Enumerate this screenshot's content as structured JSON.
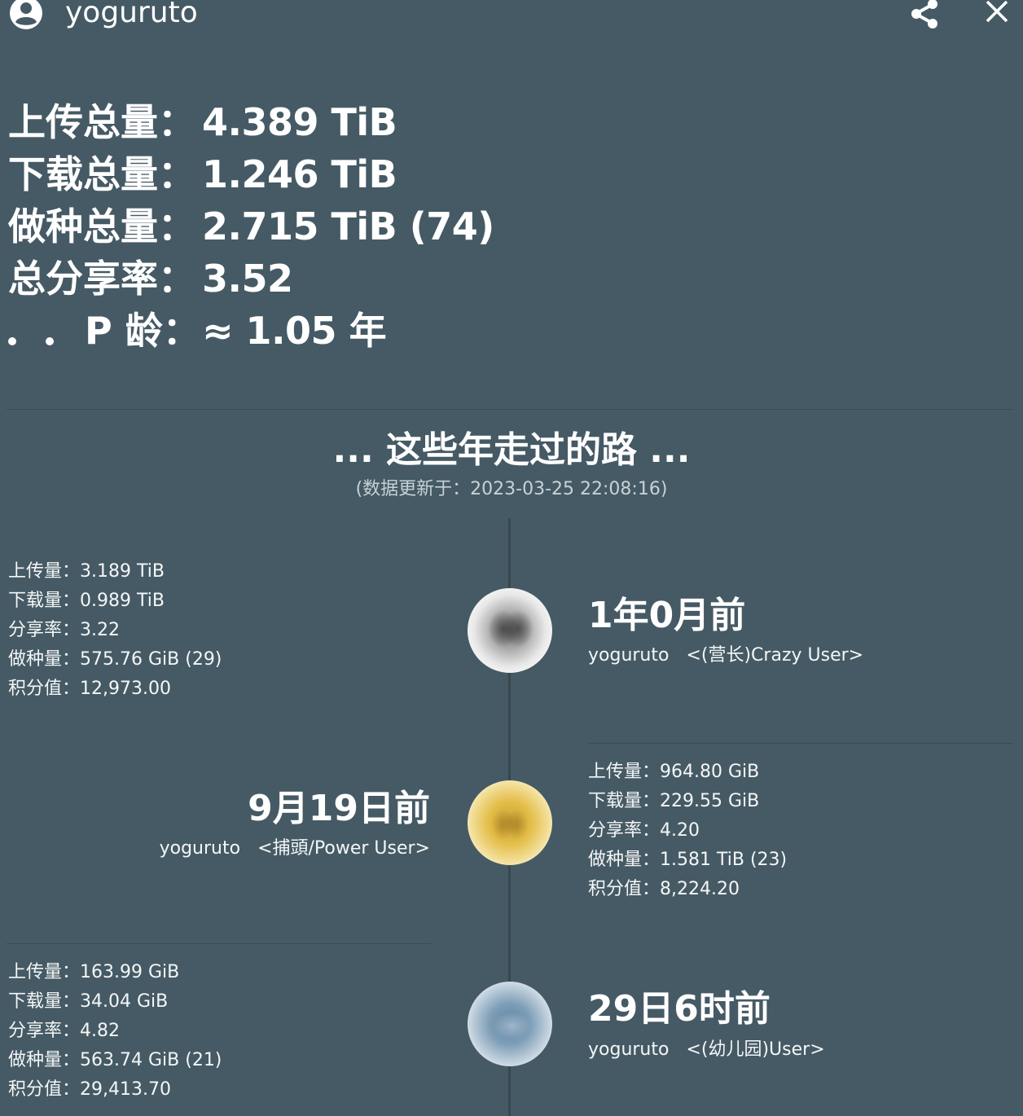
{
  "header": {
    "username": "yoguruto",
    "avatar_icon": "account-circle-icon",
    "share_icon": "share-icon",
    "close_icon": "close-icon"
  },
  "totals": [
    {
      "label": "上传总量：",
      "value": "4.389 TiB"
    },
    {
      "label": "下载总量：",
      "value": "1.246 TiB"
    },
    {
      "label": "做种总量：",
      "value": "2.715 TiB (74)"
    },
    {
      "label": "总分享率：",
      "value": "3.52"
    },
    {
      "label": "P 龄：",
      "value": "≈ 1.05 年"
    }
  ],
  "timeline": {
    "title": "... 这些年走过的路 ...",
    "subtitle": "(数据更新于：2023-03-25 22:08:16)",
    "entries": [
      {
        "ago": "1年0月前",
        "username": "yoguruto",
        "class": "<(营长)Crazy User>",
        "stats": [
          {
            "label": "上传量：",
            "value": "3.189 TiB"
          },
          {
            "label": "下载量：",
            "value": "0.989 TiB"
          },
          {
            "label": "分享率：",
            "value": "3.22"
          },
          {
            "label": "做种量：",
            "value": "575.76 GiB (29)"
          },
          {
            "label": "积分值：",
            "value": "12,973.00"
          }
        ]
      },
      {
        "ago": "9月19日前",
        "username": "yoguruto",
        "class": "<捕頭/Power User>",
        "stats": [
          {
            "label": "上传量：",
            "value": "964.80 GiB"
          },
          {
            "label": "下载量：",
            "value": "229.55 GiB"
          },
          {
            "label": "分享率：",
            "value": "4.20"
          },
          {
            "label": "做种量：",
            "value": "1.581 TiB (23)"
          },
          {
            "label": "积分值：",
            "value": "8,224.20"
          }
        ]
      },
      {
        "ago": "29日6时前",
        "username": "yoguruto",
        "class": "<(幼儿园)User>",
        "stats": [
          {
            "label": "上传量：",
            "value": "163.99 GiB"
          },
          {
            "label": "下载量：",
            "value": "34.04 GiB"
          },
          {
            "label": "分享率：",
            "value": "4.82"
          },
          {
            "label": "做种量：",
            "value": "563.74 GiB (21)"
          },
          {
            "label": "积分值：",
            "value": "29,413.70"
          }
        ]
      }
    ]
  },
  "colors": {
    "background": "#455a64",
    "timeline_line": "#37474f",
    "badge_1": "#9e9e9e",
    "badge_2": "#e6bf4a",
    "badge_3": "#7f9fb8"
  }
}
